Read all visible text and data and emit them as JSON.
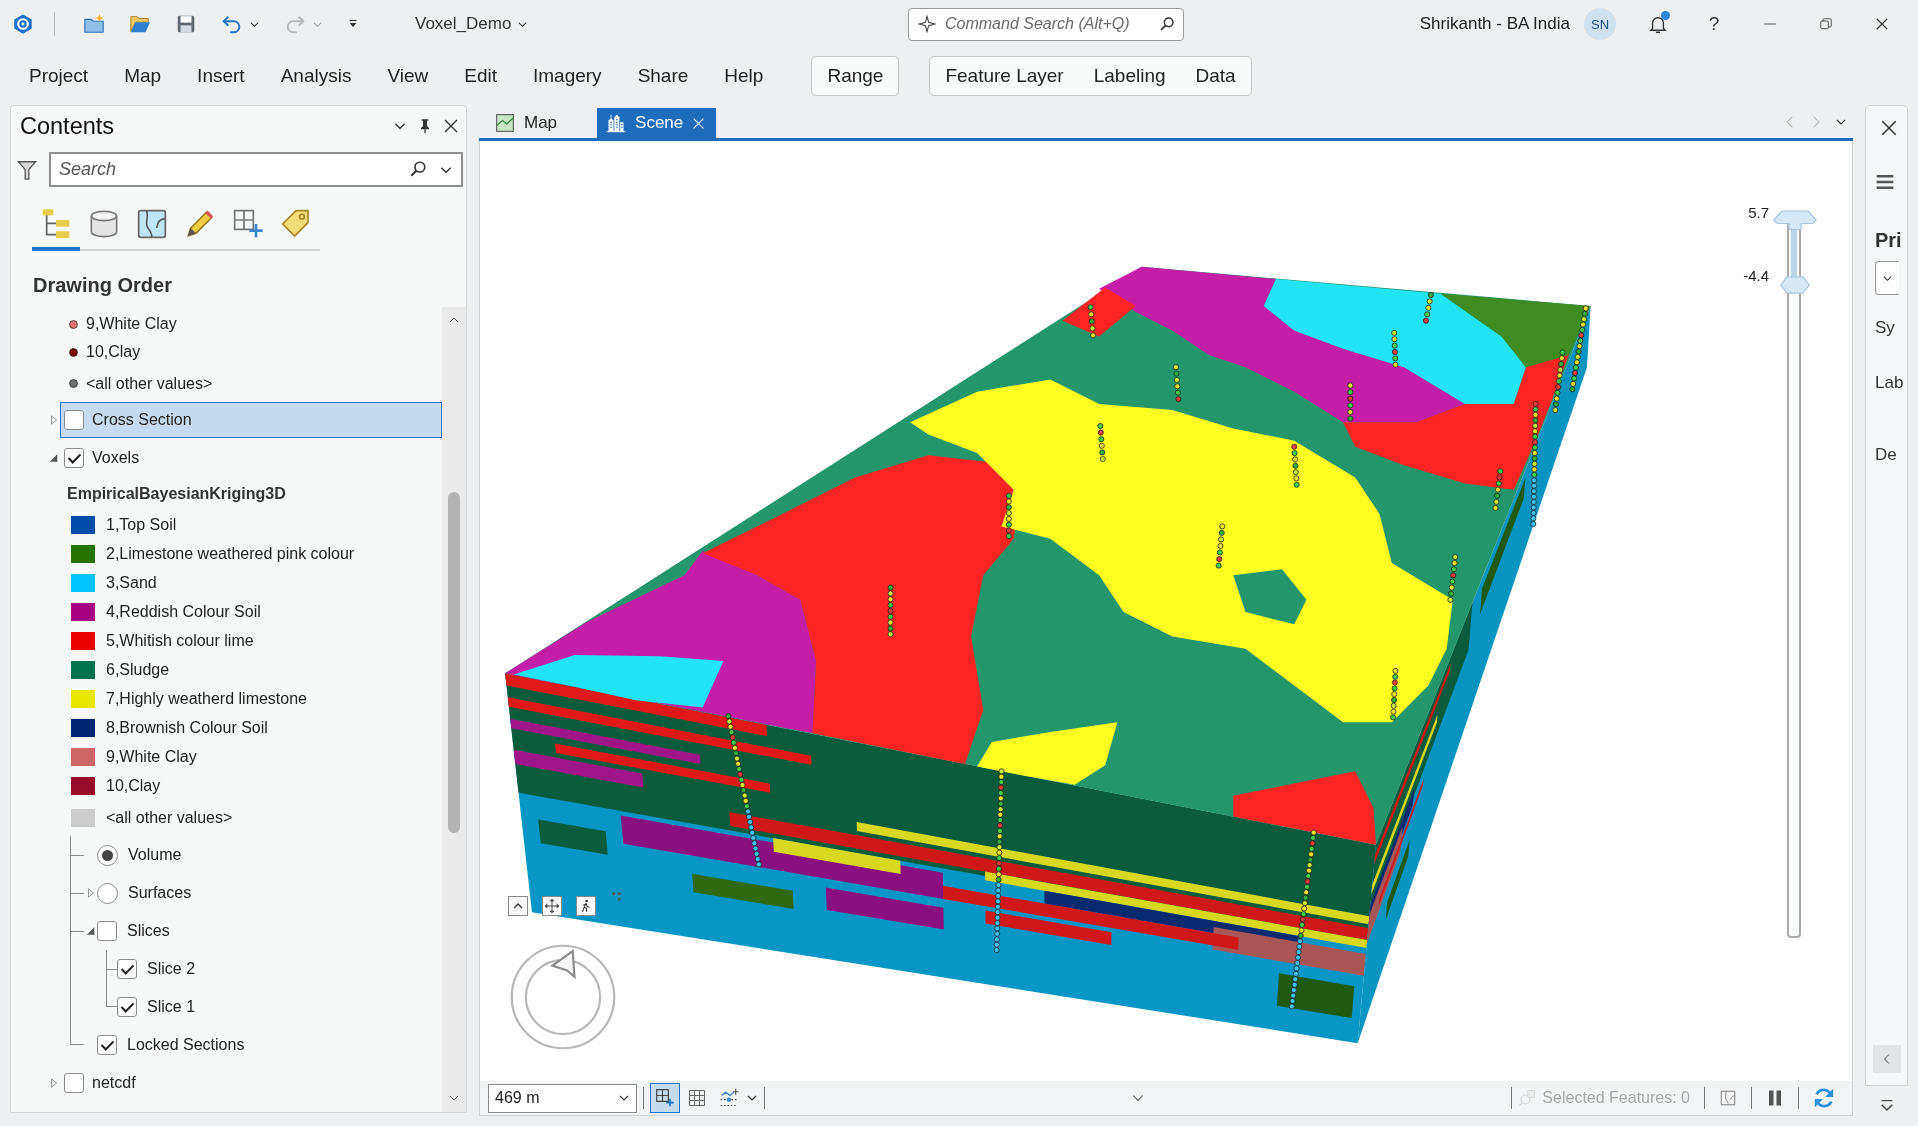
{
  "title_bar": {
    "quick_access": [
      {
        "disabled": false
      },
      {
        "disabled": false
      },
      {
        "disabled": false
      },
      {
        "disabled": false
      },
      {
        "disabled": true
      }
    ],
    "project_name": "Voxel_Demo",
    "command_search": {
      "placeholder": "Command Search (Alt+Q)"
    },
    "user_name": "Shrikanth - BA India",
    "user_initials": "SN",
    "unread_notifications": true,
    "help_label": "?"
  },
  "ribbon": {
    "tabs": [
      {
        "label": "Project",
        "selected": false
      },
      {
        "label": "Map",
        "selected": false
      },
      {
        "label": "Insert",
        "selected": false
      },
      {
        "label": "Analysis",
        "selected": false
      },
      {
        "label": "View",
        "selected": false
      },
      {
        "label": "Edit",
        "selected": false
      },
      {
        "label": "Imagery",
        "selected": false
      },
      {
        "label": "Share",
        "selected": false
      },
      {
        "label": "Help",
        "selected": false
      }
    ],
    "contextual_groups": [
      {
        "tabs": [
          {
            "label": "Range",
            "selected": false
          }
        ]
      },
      {
        "tabs": [
          {
            "label": "Feature Layer",
            "selected": false
          },
          {
            "label": "Labeling",
            "selected": false
          },
          {
            "label": "Data",
            "selected": false
          }
        ]
      }
    ]
  },
  "contents": {
    "title": "Contents",
    "search": {
      "placeholder": "Search"
    },
    "view_tabs": [
      {
        "selected": true
      },
      {
        "selected": false
      },
      {
        "selected": false
      },
      {
        "selected": false
      },
      {
        "selected": false
      },
      {
        "selected": false
      }
    ],
    "heading": "Drawing Order",
    "tree": [
      {
        "kind": "point_class",
        "label": "9,White Clay",
        "color": "#e57373"
      },
      {
        "kind": "point_class",
        "label": "10,Clay",
        "color": "#7a0000"
      },
      {
        "kind": "point_class",
        "label": "<all other values>",
        "color": "#6e6e6e"
      },
      {
        "kind": "layer",
        "label": "Cross Section",
        "checked": false,
        "expanded": false,
        "selected": true
      },
      {
        "kind": "layer",
        "label": "Voxels",
        "checked": true,
        "expanded": true,
        "selected": false,
        "children": [
          {
            "kind": "heading",
            "label": "EmpiricalBayesianKriging3D"
          },
          {
            "kind": "class",
            "label": "1,Top Soil",
            "color": "#004da8"
          },
          {
            "kind": "class",
            "label": "2,Limestone weathered pink colour",
            "color": "#267300"
          },
          {
            "kind": "class",
            "label": "3,Sand",
            "color": "#00c5ff"
          },
          {
            "kind": "class",
            "label": "4,Reddish Colour Soil",
            "color": "#a80084"
          },
          {
            "kind": "class",
            "label": "5,Whitish colour lime",
            "color": "#e60000"
          },
          {
            "kind": "class",
            "label": "6,Sludge",
            "color": "#00734c"
          },
          {
            "kind": "class",
            "label": "7,Highly weatherd limestone",
            "color": "#e6e600"
          },
          {
            "kind": "class",
            "label": "8,Brownish Colour Soil",
            "color": "#002673"
          },
          {
            "kind": "class",
            "label": "9,White Clay",
            "color": "#cd6666"
          },
          {
            "kind": "class",
            "label": "10,Clay",
            "color": "#980a2a"
          },
          {
            "kind": "class",
            "label": "<all other values>",
            "color": "#cccccc"
          },
          {
            "kind": "radio",
            "label": "Volume",
            "selected": true
          },
          {
            "kind": "radio",
            "label": "Surfaces",
            "selected": false,
            "expanded": false
          },
          {
            "kind": "group",
            "label": "Slices",
            "checked": false,
            "expanded": true,
            "children": [
              {
                "kind": "check",
                "label": "Slice 2",
                "checked": true
              },
              {
                "kind": "check",
                "label": "Slice 1",
                "checked": true
              }
            ]
          },
          {
            "kind": "check",
            "label": "Locked Sections",
            "checked": true
          }
        ]
      },
      {
        "kind": "layer",
        "label": "netcdf",
        "checked": false,
        "expanded": false,
        "selected": false
      }
    ]
  },
  "view": {
    "tabs": [
      {
        "label": "Map",
        "selected": false
      },
      {
        "label": "Scene",
        "selected": true
      }
    ],
    "range_slider": {
      "upper": {
        "reading": "5.7",
        "level": 1
      },
      "lower": {
        "reading": "-4.4",
        "level": 0.91
      }
    }
  },
  "status_bar": {
    "scale": "469 m",
    "tools": [
      {
        "pressed": true
      },
      {
        "pressed": false
      },
      {
        "pressed": false
      }
    ],
    "selected_features": {
      "label": "Selected Features: 0",
      "disabled": true
    }
  },
  "side_panel": {
    "heading": "Pri",
    "labels": [
      "Sy",
      "Lab",
      "De"
    ]
  }
}
